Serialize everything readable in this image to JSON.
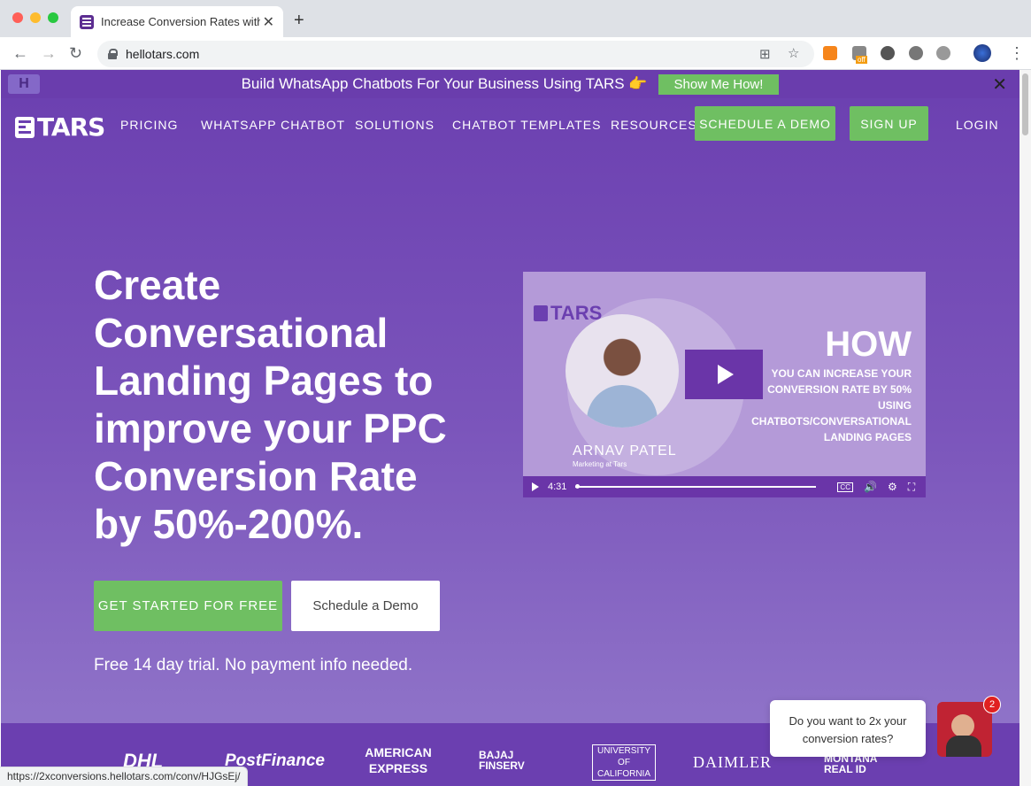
{
  "browser": {
    "tab_title": "Increase Conversion Rates with",
    "tab_close": "✕",
    "new_tab": "+",
    "url": "hellotars.com",
    "status_url": "https://2xconversions.hellotars.com/conv/HJGsEj/",
    "ext_badge": "off"
  },
  "announcement": {
    "text": "Build WhatsApp Chatbots For Your Business Using TARS 👉",
    "button": "Show Me How!",
    "close": "✕",
    "logo": "H"
  },
  "nav": {
    "brand": "TARS",
    "links": [
      "PRICING",
      "WHATSAPP CHATBOT",
      "SOLUTIONS",
      "CHATBOT TEMPLATES",
      "RESOURCES"
    ],
    "schedule_demo": "SCHEDULE A DEMO",
    "sign_up": "SIGN UP",
    "login": "LOGIN"
  },
  "hero": {
    "title": "Create Conversational Landing Pages to improve your PPC Conversion Rate by 50%-200%.",
    "cta_primary": "GET STARTED FOR FREE",
    "cta_secondary": "Schedule a Demo",
    "trial_note": "Free 14 day trial. No payment info needed."
  },
  "video": {
    "logo": "TARS",
    "headline": "HOW",
    "subline": "YOU CAN INCREASE YOUR CONVERSION RATE BY 50% USING CHATBOTS/CONVERSATIONAL LANDING PAGES",
    "speaker_name": "ARNAV PATEL",
    "speaker_role": "Marketing at Tars",
    "duration": "4:31",
    "cc": "CC",
    "volume_icon": "🔊",
    "settings_icon": "⚙",
    "fullscreen_icon": "⛶"
  },
  "logos": [
    "DHL",
    "PostFinance",
    "AMERICAN EXPRESS",
    "BAJAJ FINSERV",
    "UNIVERSITY OF CALIFORNIA",
    "DAIMLER",
    "MONTANA REAL ID"
  ],
  "chat": {
    "message": "Do you want to 2x your conversion rates?",
    "badge": "2"
  }
}
